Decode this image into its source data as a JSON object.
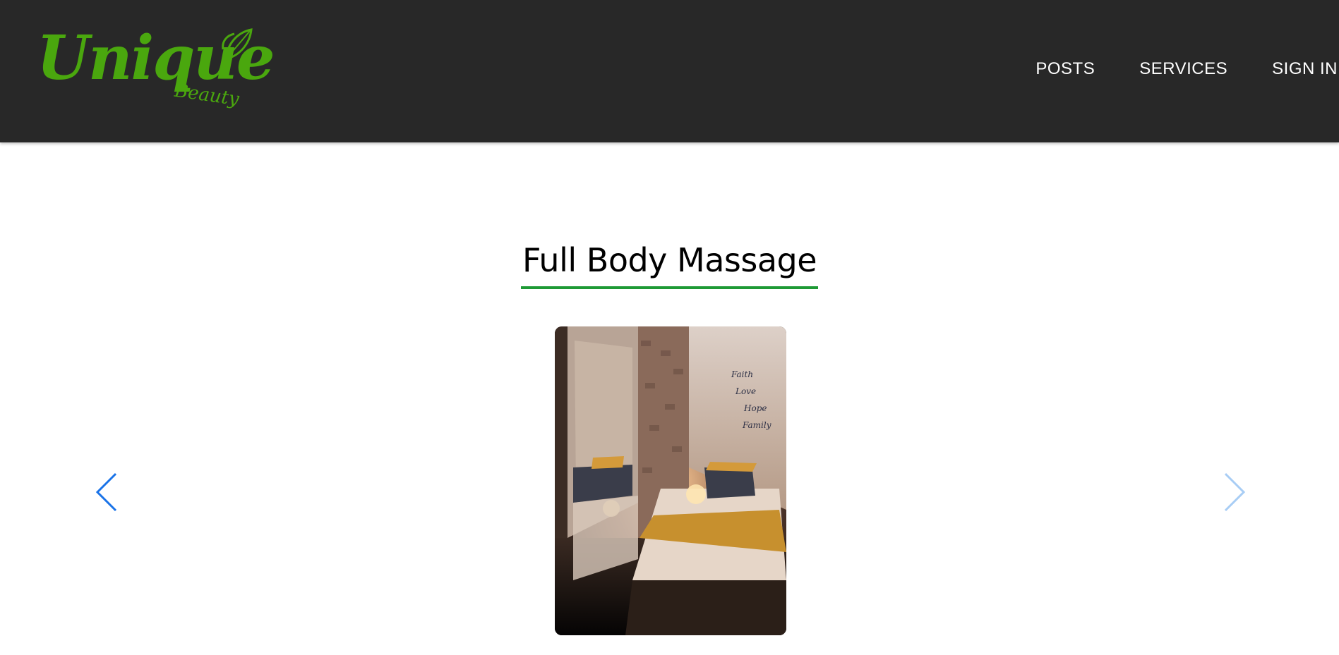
{
  "brand": {
    "name": "Unique",
    "tagline": "Beauty",
    "color": "#4aa70e"
  },
  "nav": {
    "items": [
      {
        "label": "POSTS"
      },
      {
        "label": "SERVICES"
      },
      {
        "label": "SIGN IN"
      }
    ]
  },
  "main": {
    "title": "Full Body Massage",
    "title_underline_color": "#1e9a35"
  },
  "carousel": {
    "prev_icon": "chevron-left-icon",
    "next_icon": "chevron-right-icon",
    "prev_color": "#1a73e8",
    "next_color": "#a8cdf5",
    "photo_wall_text": [
      "Faith",
      "Love",
      "Hope",
      "Family"
    ]
  },
  "colors": {
    "header_bg": "#282828",
    "nav_text": "#ffffff",
    "page_bg": "#ffffff"
  }
}
